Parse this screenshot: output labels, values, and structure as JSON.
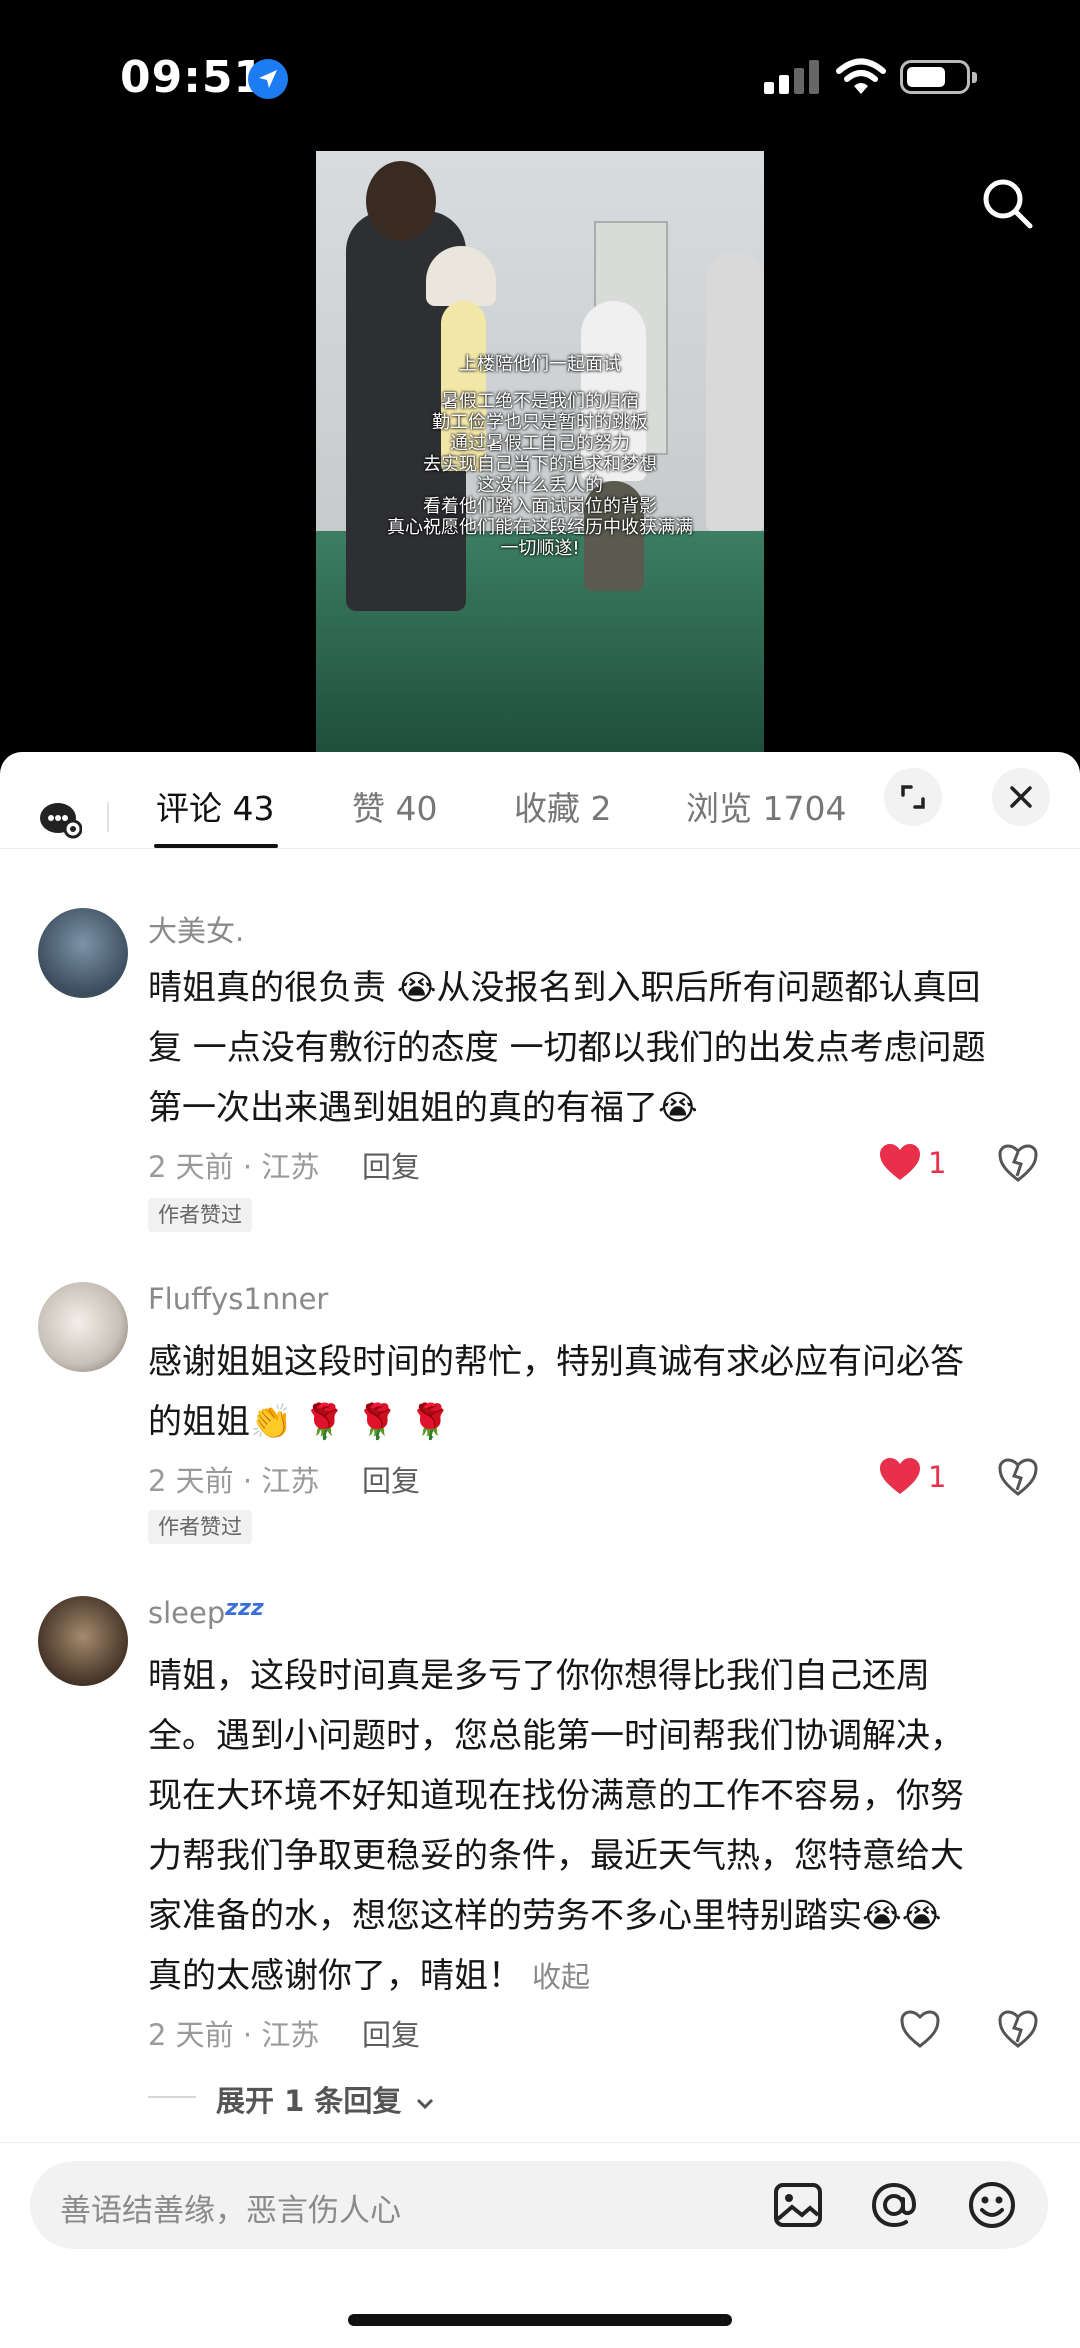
{
  "status_bar": {
    "time": "09:51"
  },
  "video": {
    "subtitles": [
      "上楼陪他们一起面试",
      "",
      "暑假工绝不是我们的归宿",
      "勤工俭学也只是暂时的跳板",
      "通过暑假工自己的努力",
      "去实现自己当下的追求和梦想",
      "这没什么丢人的",
      "看着他们踏入面试岗位的背影",
      "真心祝愿他们能在这段经历中收获满满",
      "一切顺遂!"
    ]
  },
  "tabs": [
    {
      "label": "评论 43",
      "active": true
    },
    {
      "label": "赞 40",
      "active": false
    },
    {
      "label": "收藏 2",
      "active": false
    },
    {
      "label": "浏览 1704",
      "active": false
    }
  ],
  "comments": [
    {
      "username": "大美女.",
      "lines": [
        "晴姐真的很负责 😭从没报名到入职后所有问题都认真回",
        "复 一点没有敷衍的态度 一切都以我们的出发点考虑问题",
        "第一次出来遇到姐姐的真的有福了😭"
      ],
      "meta": "2 天前 · 江苏",
      "reply": "回复",
      "badge": "作者赞过",
      "likes": "1"
    },
    {
      "username": "Fluffys1nner",
      "lines": [
        "感谢姐姐这段时间的帮忙，特别真诚有求必应有问必答",
        "的姐姐👏 🌹 🌹 🌹"
      ],
      "meta": "2 天前 · 江苏",
      "reply": "回复",
      "badge": "作者赞过",
      "likes": "1"
    },
    {
      "username": "sleep",
      "username_suffix": "zzz",
      "lines": [
        "晴姐，这段时间真是多亏了你你想得比我们自己还周",
        "全。遇到小问题时，您总能第一时间帮我们协调解决，",
        "现在大环境不好知道现在找份满意的工作不容易，你努",
        "力帮我们争取更稳妥的条件，最近天气热，您特意给大",
        "家准备的水，想您这样的劳务不多心里特别踏实😭😭",
        "真的太感谢你了，晴姐！"
      ],
      "fold": "收起",
      "meta": "2 天前 · 江苏",
      "reply": "回复",
      "expand": "展开 1 条回复"
    }
  ],
  "input": {
    "placeholder": "善语结善缘，恶言伤人心"
  },
  "colors": {
    "like_red": "#e8304a",
    "accent_blue": "#1e7cf2"
  }
}
